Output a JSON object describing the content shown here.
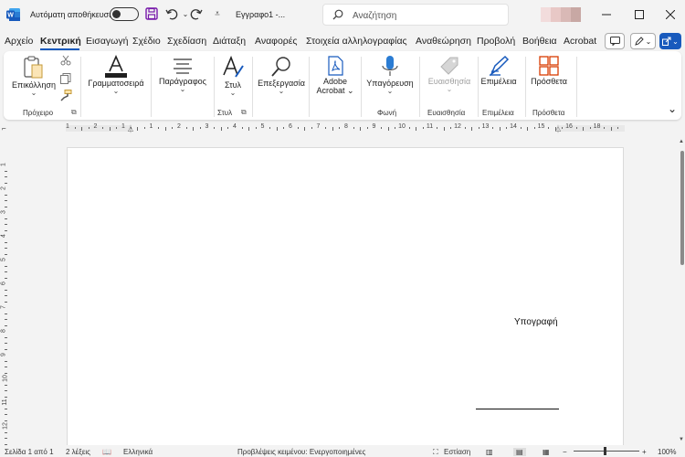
{
  "titlebar": {
    "autosave_label": "Αυτόματη αποθήκευση",
    "doc_title": "Εγγραφο1  -...",
    "search_placeholder": "Αναζήτηση"
  },
  "tabs": [
    "Αρχείο",
    "Κεντρική",
    "Εισαγωγή",
    "Σχέδιο",
    "Σχεδίαση",
    "Διάταξη",
    "Αναφορές",
    "Στοιχεία αλληλογραφίας",
    "Αναθεώρηση",
    "Προβολή",
    "Βοήθεια",
    "Acrobat"
  ],
  "active_tab": "Κεντρική",
  "ribbon": {
    "paste": "Επικόλληση",
    "font": "Γραμματοσειρά",
    "paragraph": "Παράγραφος",
    "styles": "Στυλ",
    "editing": "Επεξεργασία",
    "adobe_acrobat_line1": "Adobe",
    "adobe_acrobat_line2": "Acrobat",
    "dictate": "Υπαγόρευση",
    "sensitivity": "Ευαισθησία",
    "editor": "Επιμέλεια",
    "addins": "Πρόσθετα",
    "groups": {
      "clipboard": "Πρόχειρο",
      "styles": "Στυλ",
      "voice": "Φωνή",
      "sensitivity": "Ευαισθησία",
      "editor": "Επιμέλεια",
      "addins": "Πρόσθετα"
    }
  },
  "ruler_numbers": [
    "1",
    "2",
    "1",
    "1",
    "2",
    "3",
    "4",
    "5",
    "6",
    "7",
    "8",
    "9",
    "10",
    "11",
    "12",
    "13",
    "14",
    "15",
    "16",
    "18"
  ],
  "vruler_numbers": [
    "1",
    "2",
    "3",
    "4",
    "5",
    "6",
    "7",
    "8",
    "9",
    "10",
    "11",
    "12"
  ],
  "document": {
    "signature_label": "Υπογραφή"
  },
  "statusbar": {
    "page": "Σελίδα 1 από 1",
    "words": "2 λέξεις",
    "language": "Ελληνικά",
    "predictions": "Προβλέψεις κειμένου: Ενεργοποιημένες",
    "focus": "Εστίαση",
    "zoom": "100%"
  },
  "colors": {
    "accent": "#185abd",
    "addins_orange": "#d83b01",
    "editor_blue": "#185abd"
  }
}
